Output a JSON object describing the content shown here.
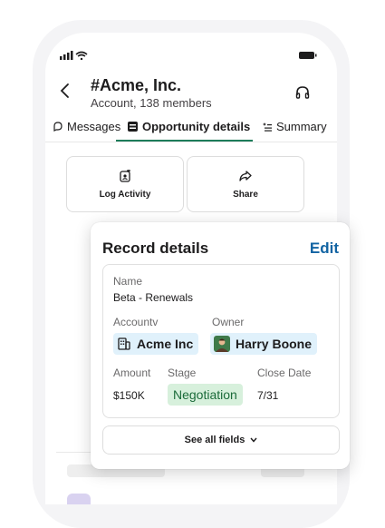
{
  "header": {
    "channel_name": "Acme, Inc.",
    "channel_prefix": "#",
    "channel_sub": "Account, 138 members"
  },
  "tabs": [
    {
      "label": "Messages",
      "icon": "messages-icon"
    },
    {
      "label": "Opportunity details",
      "icon": "record-icon"
    },
    {
      "label": "Summary",
      "icon": "summary-icon"
    }
  ],
  "actions": {
    "log_activity": "Log Activity",
    "share": "Share"
  },
  "record": {
    "title": "Record details",
    "edit_label": "Edit",
    "name_label": "Name",
    "name_value": "Beta - Renewals",
    "account_label": "Accountv",
    "account_value": "Acme Inc",
    "owner_label": "Owner",
    "owner_value": "Harry Boone",
    "amount_label": "Amount",
    "amount_value": "$150K",
    "stage_label": "Stage",
    "stage_value": "Negotiation",
    "close_label": "Close Date",
    "close_value": "7/31",
    "see_all": "See all fields"
  },
  "colors": {
    "accent_link": "#1264a3",
    "tab_underline": "#1d7c5a",
    "chip_blue": "#e0f1fb",
    "chip_green": "#d7f0dc"
  }
}
